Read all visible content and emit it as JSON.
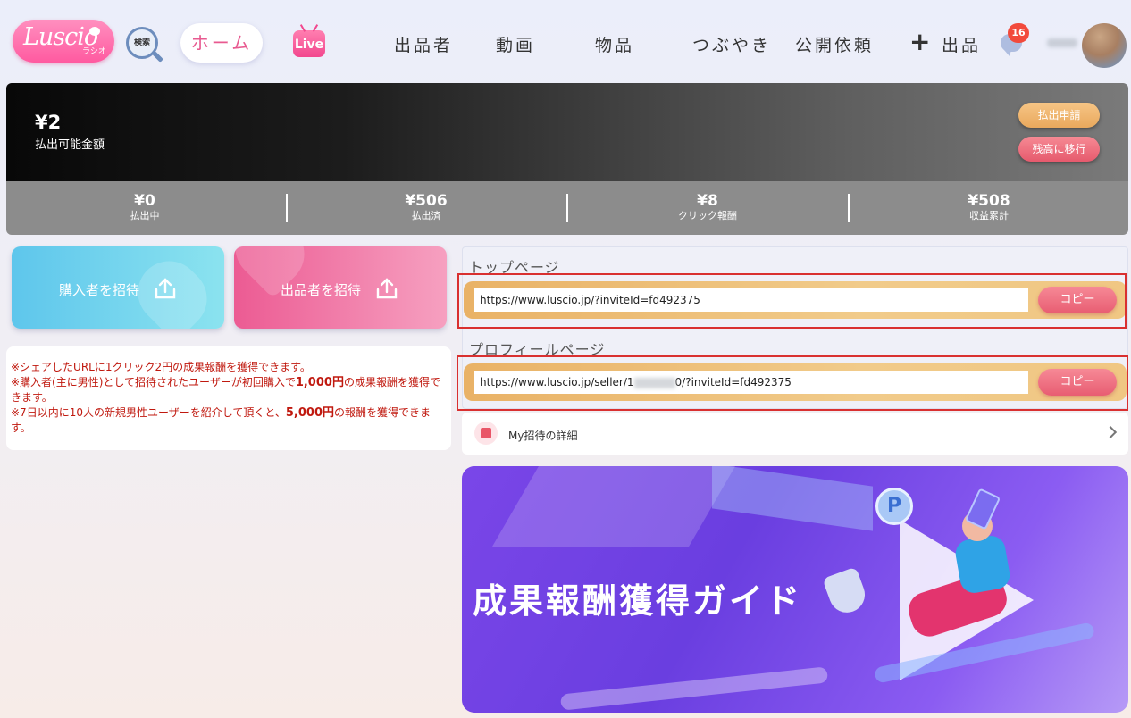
{
  "header": {
    "logo_text": "Luscio",
    "logo_sub": "ラシオ",
    "search_label": "検索",
    "home_label": "ホーム",
    "live_label": "Live",
    "nav": [
      "出品者",
      "動画",
      "物品",
      "つぶやき",
      "公開依頼"
    ],
    "post_label": "出品",
    "notification_count": "16"
  },
  "balance": {
    "amount": "¥2",
    "label": "払出可能金額",
    "withdraw_button": "払出申請",
    "transfer_button": "残高に移行"
  },
  "stats": [
    {
      "value": "¥0",
      "label": "払出中"
    },
    {
      "value": "¥506",
      "label": "払出済"
    },
    {
      "value": "¥8",
      "label": "クリック報酬"
    },
    {
      "value": "¥508",
      "label": "収益累計"
    }
  ],
  "invite": {
    "buyer_label": "購入者を招待",
    "seller_label": "出品者を招待"
  },
  "notes": {
    "n1": "※シェアしたURLに1クリック2円の成果報酬を獲得できます。",
    "n2_a": "※購入者(主に男性)として招待されたユーザーが初回購入で",
    "n2_b": "1,000円",
    "n2_c": "の成果報酬を獲得できます。",
    "n3_a": "※7日以内に10人の新規男性ユーザーを紹介して頂くと、",
    "n3_b": "5,000円",
    "n3_c": "の報酬を獲得できます。"
  },
  "links": {
    "top_title": "トップページ",
    "top_url": "https://www.luscio.jp/?inviteId=fd492375",
    "profile_title": "プロフィールページ",
    "profile_url_prefix": "https://www.luscio.jp/seller/1",
    "profile_url_suffix": "0/?inviteId=fd492375",
    "copy_label": "コピー"
  },
  "detail": {
    "label": "My招待の詳細"
  },
  "guide": {
    "title": "成果報酬獲得ガイド",
    "coin_letter": "P"
  },
  "colors": {
    "accent_pink": "#e85a90",
    "highlight_red": "#d93030",
    "note_red": "#c0190f",
    "gold": "#e9b266"
  }
}
